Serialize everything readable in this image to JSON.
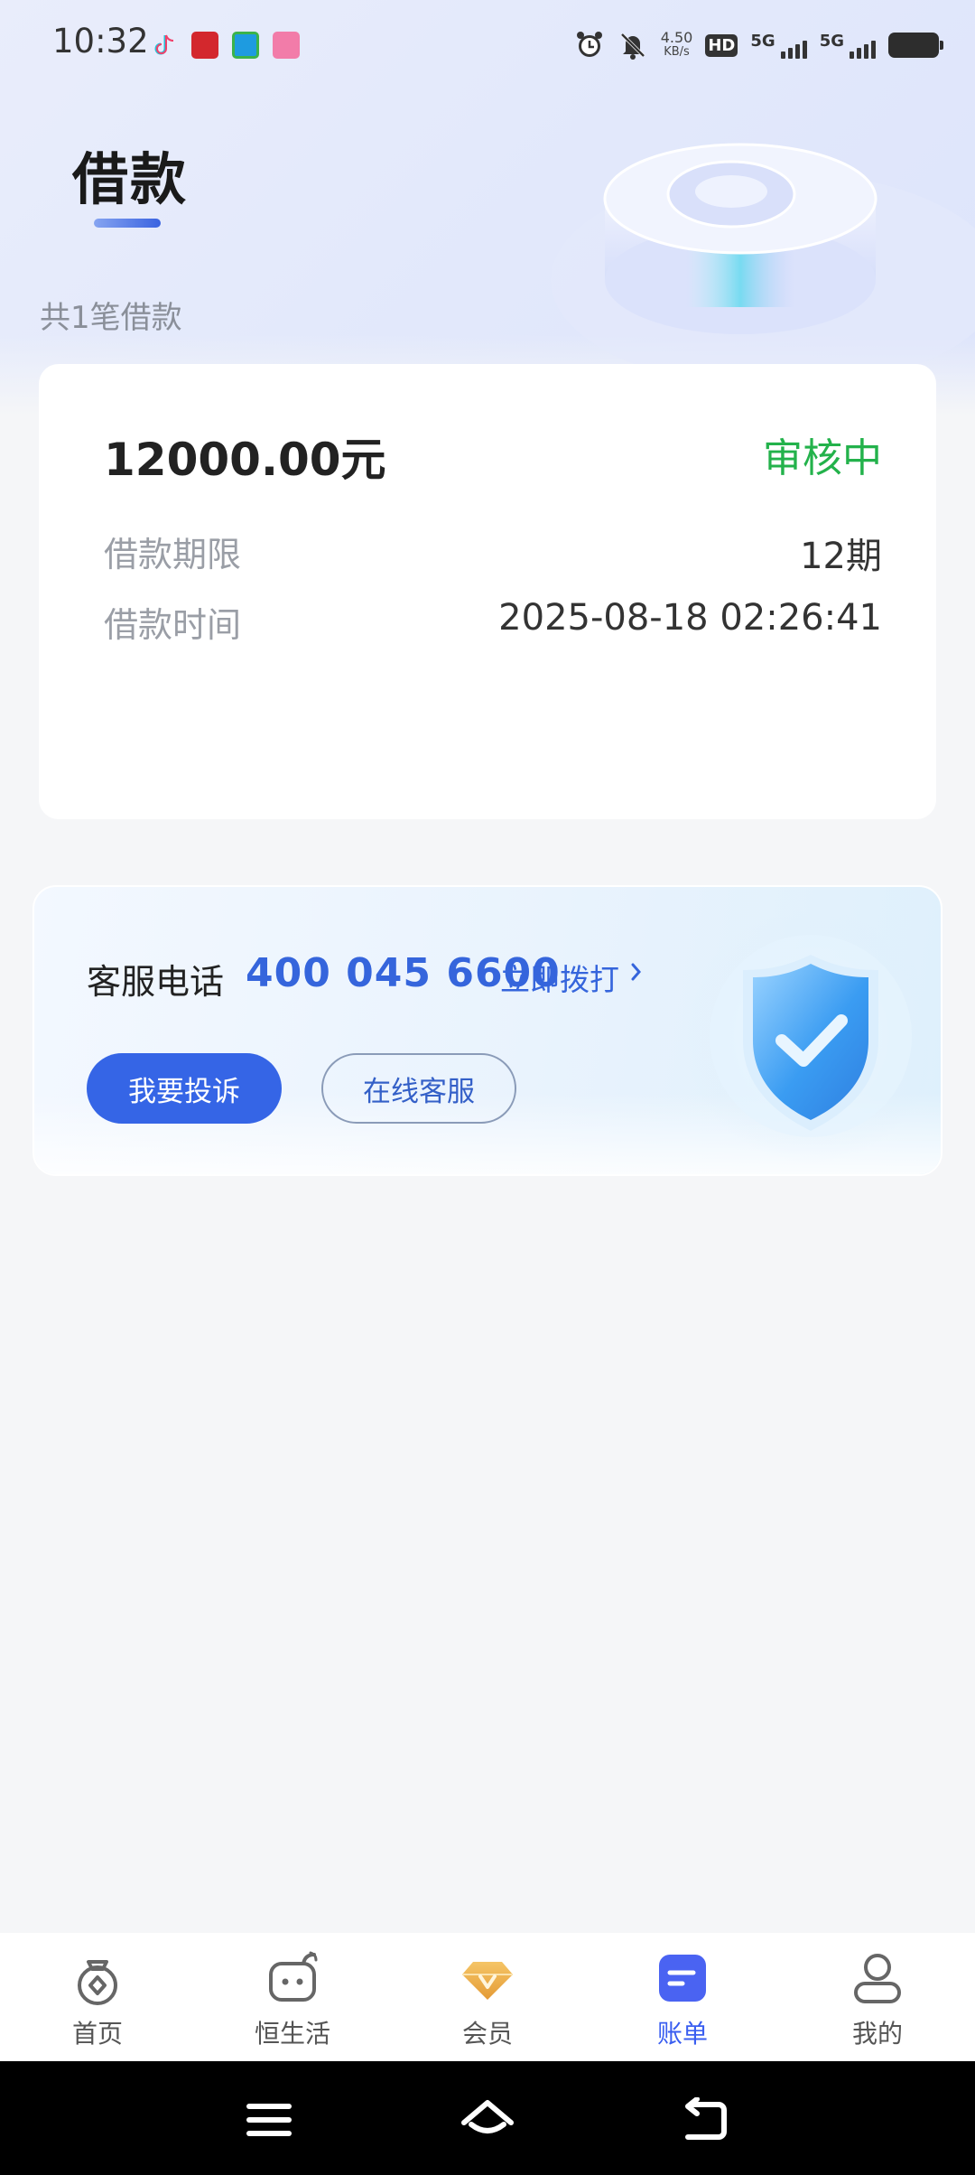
{
  "status_bar": {
    "time": "10:32",
    "net_speed_value": "4.50",
    "net_speed_unit": "KB/s",
    "hd_label": "HD",
    "signal1": "5G",
    "signal2": "5G",
    "icons": [
      "tiktok-icon",
      "app-red-icon",
      "app-green-icon",
      "bilibili-icon",
      "alarm-icon",
      "mute-icon",
      "battery-icon"
    ]
  },
  "header": {
    "title": "借款",
    "loan_count": "共1笔借款"
  },
  "loan": {
    "amount": "12000.00元",
    "status": "审核中",
    "term_label": "借款期限",
    "term_value": "12期",
    "time_label": "借款时间",
    "time_value": "2025-08-18 02:26:41"
  },
  "service": {
    "label": "客服电话",
    "phone": "400 045 6600",
    "call_label": "立即拨打",
    "complain_label": "我要投诉",
    "online_label": "在线客服"
  },
  "nav": {
    "items": [
      {
        "label": "首页",
        "icon": "home-money-bag-icon"
      },
      {
        "label": "恒生活",
        "icon": "life-robot-icon"
      },
      {
        "label": "会员",
        "icon": "vip-diamond-icon"
      },
      {
        "label": "账单",
        "icon": "bill-document-icon",
        "active": true
      },
      {
        "label": "我的",
        "icon": "user-profile-icon"
      }
    ]
  },
  "colors": {
    "accent": "#3565e6",
    "status_green": "#23b24b",
    "nav_active": "#3a5ef0"
  }
}
